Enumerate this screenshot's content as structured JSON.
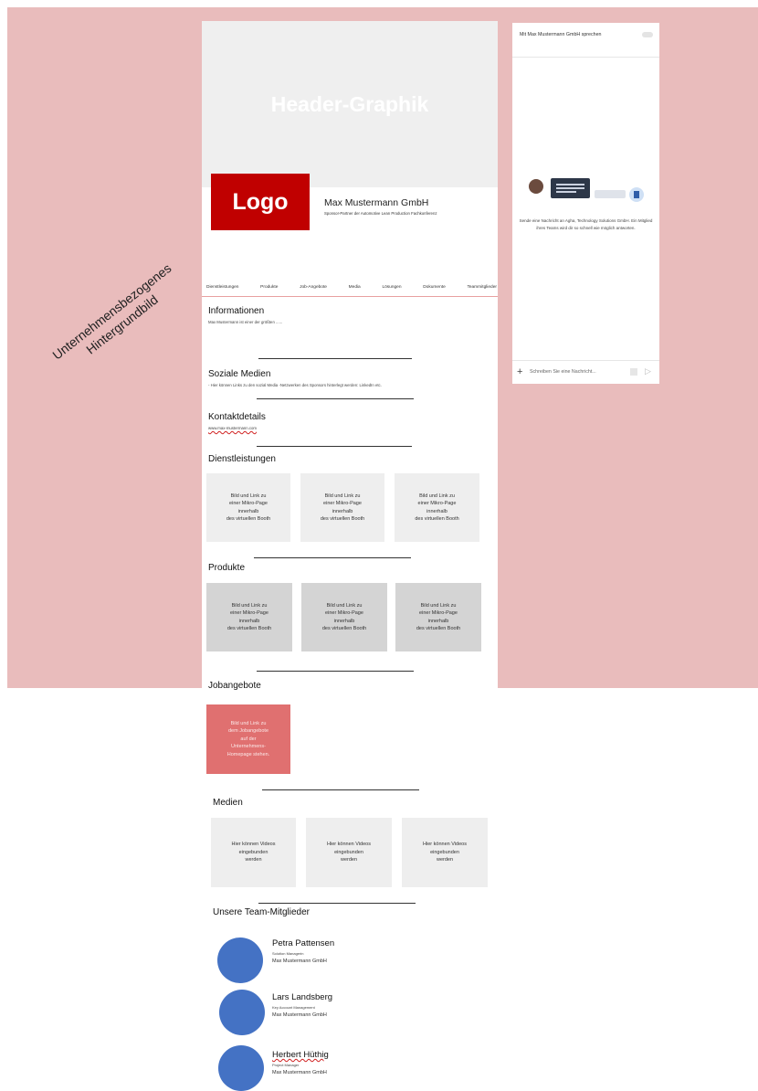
{
  "background": {
    "label_line1": "Unternehmensbezogenes",
    "label_line2": "Hintergrundbild",
    "color": "#e9bcbc"
  },
  "header": {
    "graphic_label": "Header-Graphik",
    "logo_label": "Logo",
    "company_name": "Max Mustermann GmbH",
    "company_subtitle": "Sponsor-Partner der Automotive Lean Production Fachkonferenz"
  },
  "tabs": [
    "Dienstleistungen",
    "Produkte",
    "Job-Angebote",
    "Media",
    "Lösungen",
    "Dokumente",
    "Teammitglieder"
  ],
  "sections": {
    "informationen": {
      "title": "Informationen",
      "text": "Max Mustermann ist einer der größten ......"
    },
    "soziale_medien": {
      "title": "Soziale Medien",
      "text": "- Hier können Links zu den sozial Media -Netzwerken des Sponsors hinterlegt werden: LinkedIn etc."
    },
    "kontaktdetails": {
      "title": "Kontaktdetails",
      "text": "www.max-mustermann.com"
    },
    "dienstleistungen": {
      "title": "Dienstleistungen",
      "cards": [
        [
          "Bild und Link zu",
          "einer Mikro-Page",
          "innerhalb",
          "des virtuellen Booth"
        ],
        [
          "Bild und Link zu",
          "einer Mikro-Page",
          "innerhalb",
          "des virtuellen Booth"
        ],
        [
          "Bild und Link zu",
          "einer Mikro-Page",
          "innerhalb",
          "des virtuellen Booth"
        ]
      ]
    },
    "produkte": {
      "title": "Produkte",
      "cards": [
        [
          "Bild und Link zu",
          "einer Mikro-Page",
          "innerhalb",
          "des virtuellen Booth"
        ],
        [
          "Bild und Link zu",
          "einer Mikro-Page",
          "innerhalb",
          "des virtuellen Booth"
        ],
        [
          "Bild und Link zu",
          "einer Mikro-Page",
          "innerhalb",
          "des virtuellen Booth"
        ]
      ]
    },
    "jobangebote": {
      "title": "Jobangebote",
      "card": [
        "Bild und Link zu",
        "dem Jobangebote",
        "auf der",
        "Unternehmens-",
        "Homepage stehen."
      ]
    },
    "medien": {
      "title": "Medien",
      "cards": [
        [
          "Hier können Videos",
          "eingebunden",
          "werden"
        ],
        [
          "Hier können Videos",
          "eingebunden",
          "werden"
        ],
        [
          "Hier können Videos",
          "eingebunden",
          "werden"
        ]
      ]
    },
    "team": {
      "title": "Unsere Team-Mitglieder",
      "members": [
        {
          "name": "Petra Pattensen",
          "role": "Solution Managerin",
          "company": "Max Mustermann GmbH"
        },
        {
          "name": "Lars Landsberg",
          "role": "Key Account Management",
          "company": "Max Mustermann GmbH"
        },
        {
          "name": "Herbert Hüthig",
          "role": "Project Manager",
          "company": "Max Mustermann GmbH"
        }
      ]
    }
  },
  "chat": {
    "title": "Mit Max Mustermann GmbH sprechen",
    "description": "Sende eine Nachricht an Agha, Technology Solutions GmbH. Ein Mitglied ihres Teams wird dir so schnell wie möglich antworten.",
    "input_placeholder": "Schreiben Sie eine Nachricht..."
  }
}
